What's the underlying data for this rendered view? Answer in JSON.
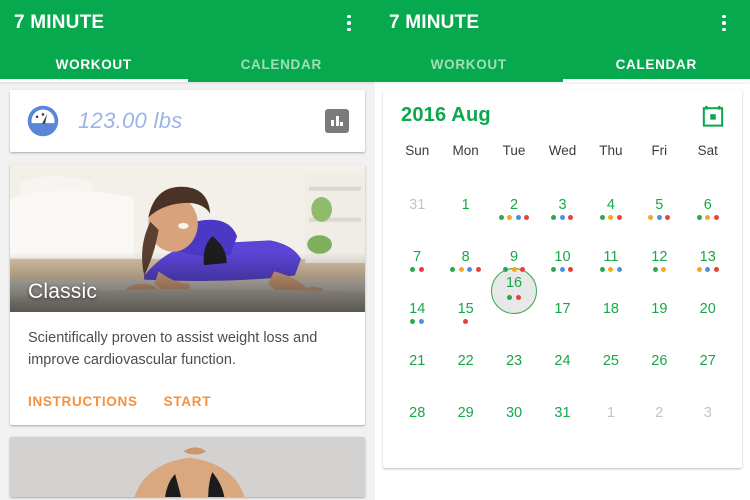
{
  "app": {
    "title": "7 MINUTE",
    "overflow_icon": "overflow-menu-icon",
    "accent_green": "#06a94e",
    "accent_orange": "#f6903c",
    "calendar_green": "#17a64a"
  },
  "left_panel": {
    "tabs": [
      {
        "label": "WORKOUT",
        "active": true
      },
      {
        "label": "CALENDAR",
        "active": false
      }
    ],
    "weight_card": {
      "icon": "scale-gauge-icon",
      "value": "123.00 lbs",
      "chart_button_icon": "bar-chart-icon"
    },
    "workout_card": {
      "title": "Classic",
      "description": "Scientifically proven to assist weight loss and improve cardiovascular function.",
      "instructions_label": "INSTRUCTIONS",
      "start_label": "START"
    }
  },
  "right_panel": {
    "tabs": [
      {
        "label": "WORKOUT",
        "active": false
      },
      {
        "label": "CALENDAR",
        "active": true
      }
    ],
    "calendar": {
      "month_label": "2016 Aug",
      "icon": "calendar-icon",
      "weekdays": [
        "Sun",
        "Mon",
        "Tue",
        "Wed",
        "Thu",
        "Fri",
        "Sat"
      ],
      "selected_day": 16,
      "dot_colors": {
        "green": "#2aa84a",
        "orange": "#f5a623",
        "blue": "#4a90e2",
        "red": "#e8413a"
      },
      "weeks": [
        [
          {
            "day": "31",
            "out": true,
            "dots": []
          },
          {
            "day": "1",
            "out": false,
            "dots": []
          },
          {
            "day": "2",
            "out": false,
            "dots": [
              "green",
              "orange",
              "blue",
              "red"
            ]
          },
          {
            "day": "3",
            "out": false,
            "dots": [
              "green",
              "blue",
              "red"
            ]
          },
          {
            "day": "4",
            "out": false,
            "dots": [
              "green",
              "orange",
              "red"
            ]
          },
          {
            "day": "5",
            "out": false,
            "dots": [
              "orange",
              "blue",
              "red"
            ]
          },
          {
            "day": "6",
            "out": false,
            "dots": [
              "green",
              "orange",
              "red"
            ]
          }
        ],
        [
          {
            "day": "7",
            "out": false,
            "dots": [
              "green",
              "red"
            ]
          },
          {
            "day": "8",
            "out": false,
            "dots": [
              "green",
              "orange",
              "blue",
              "red"
            ]
          },
          {
            "day": "9",
            "out": false,
            "dots": [
              "green",
              "orange",
              "red"
            ]
          },
          {
            "day": "10",
            "out": false,
            "dots": [
              "green",
              "blue",
              "red"
            ]
          },
          {
            "day": "11",
            "out": false,
            "dots": [
              "green",
              "orange",
              "blue"
            ]
          },
          {
            "day": "12",
            "out": false,
            "dots": [
              "green",
              "orange"
            ]
          },
          {
            "day": "13",
            "out": false,
            "dots": [
              "orange",
              "blue",
              "red"
            ]
          }
        ],
        [
          {
            "day": "14",
            "out": false,
            "dots": [
              "green",
              "blue"
            ]
          },
          {
            "day": "15",
            "out": false,
            "dots": [
              "red"
            ]
          },
          {
            "day": "16",
            "out": false,
            "dots": [
              "green",
              "red"
            ],
            "selected": true
          },
          {
            "day": "17",
            "out": false,
            "dots": []
          },
          {
            "day": "18",
            "out": false,
            "dots": []
          },
          {
            "day": "19",
            "out": false,
            "dots": []
          },
          {
            "day": "20",
            "out": false,
            "dots": []
          }
        ],
        [
          {
            "day": "21",
            "out": false,
            "dots": []
          },
          {
            "day": "22",
            "out": false,
            "dots": []
          },
          {
            "day": "23",
            "out": false,
            "dots": []
          },
          {
            "day": "24",
            "out": false,
            "dots": []
          },
          {
            "day": "25",
            "out": false,
            "dots": []
          },
          {
            "day": "26",
            "out": false,
            "dots": []
          },
          {
            "day": "27",
            "out": false,
            "dots": []
          }
        ],
        [
          {
            "day": "28",
            "out": false,
            "dots": []
          },
          {
            "day": "29",
            "out": false,
            "dots": []
          },
          {
            "day": "30",
            "out": false,
            "dots": []
          },
          {
            "day": "31",
            "out": false,
            "dots": []
          },
          {
            "day": "1",
            "out": true,
            "dots": []
          },
          {
            "day": "2",
            "out": true,
            "dots": []
          },
          {
            "day": "3",
            "out": true,
            "dots": []
          }
        ]
      ]
    }
  }
}
